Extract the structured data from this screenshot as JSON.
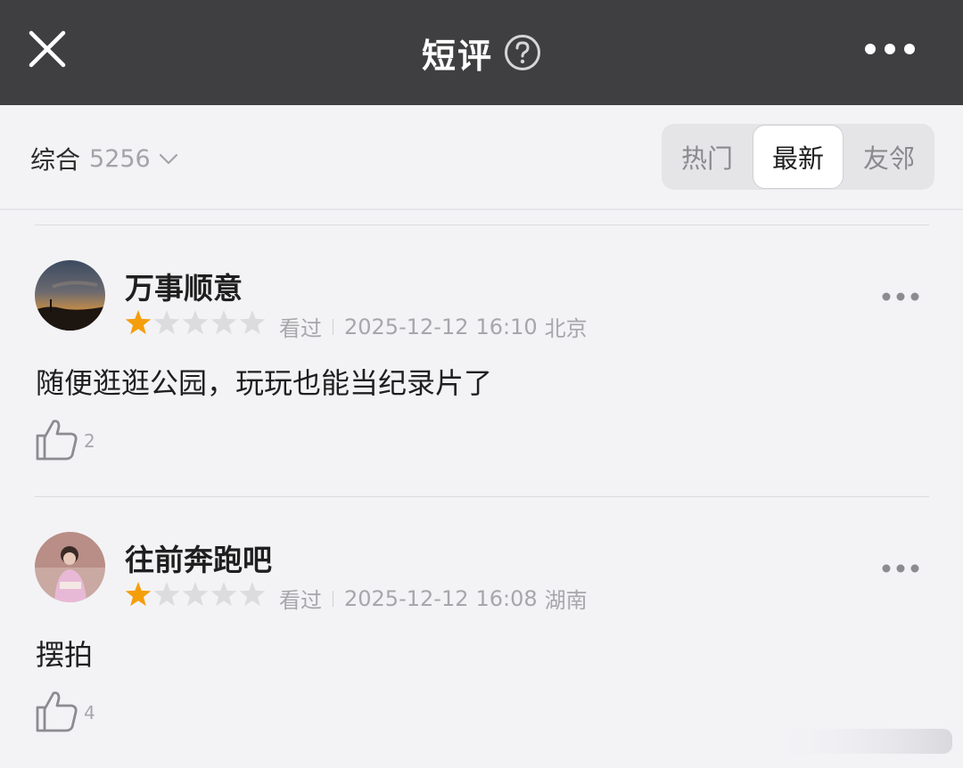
{
  "header": {
    "title": "短评",
    "close_icon": "close-icon",
    "help_icon": "question-circle-icon",
    "more_icon": "more-horizontal-icon"
  },
  "filter": {
    "sort_label": "综合",
    "count": "5256",
    "tabs": [
      {
        "label": "热门",
        "active": false
      },
      {
        "label": "最新",
        "active": true
      },
      {
        "label": "友邻",
        "active": false
      }
    ]
  },
  "reviews": [
    {
      "username": "万事顺意",
      "rating": 1,
      "max_rating": 5,
      "status": "看过",
      "date": "2025-12-12",
      "time": "16:10",
      "location": "北京",
      "content": "随便逛逛公园，玩玩也能当纪录片了",
      "likes": "2"
    },
    {
      "username": "往前奔跑吧",
      "rating": 1,
      "max_rating": 5,
      "status": "看过",
      "date": "2025-12-12",
      "time": "16:08",
      "location": "湖南",
      "content": "摆拍",
      "likes": "4"
    }
  ],
  "colors": {
    "header_bg": "#3f3f41",
    "page_bg": "#f3f3f6",
    "star_filled": "#f59e0b",
    "star_empty": "#dcdcdf"
  }
}
